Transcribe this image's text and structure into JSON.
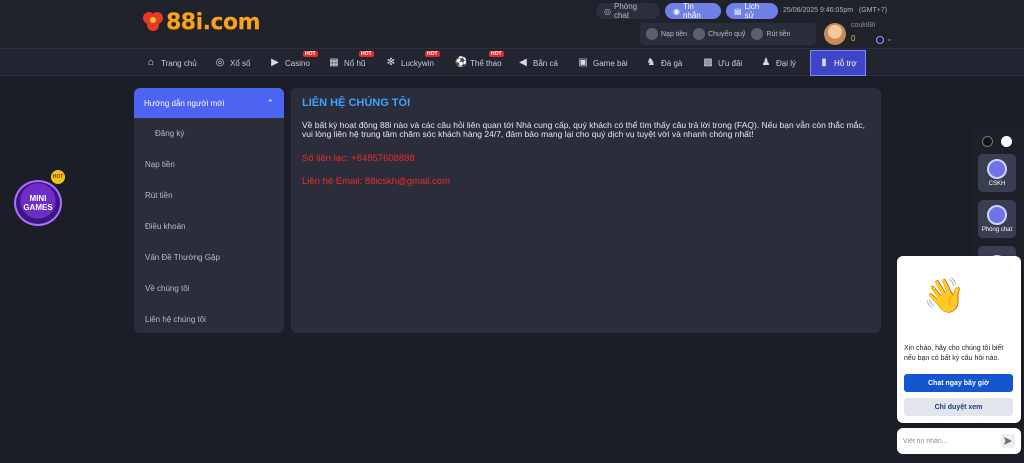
{
  "header": {
    "logo_text": "88i.com",
    "chat_room_label": "Phòng chat",
    "messages_label": "Tin nhắn",
    "history_label": "Lịch sử",
    "datetime": "25/06/2025 9:46:05pm",
    "timezone": "(GMT+7)",
    "deposit_label": "Nạp tiền",
    "transfer_label": "Chuyển quỹ",
    "withdraw_label": "Rút tiền",
    "username": "couk88i",
    "balance": "0"
  },
  "nav": {
    "hot_tag": "HOT",
    "items": [
      {
        "label": "Trang chủ"
      },
      {
        "label": "Xổ số"
      },
      {
        "label": "Casino"
      },
      {
        "label": "Nổ hũ"
      },
      {
        "label": "Luckywin"
      },
      {
        "label": "Thể thao"
      },
      {
        "label": "Bắn cá"
      },
      {
        "label": "Game bài"
      },
      {
        "label": "Đá gà"
      },
      {
        "label": "Ưu đãi"
      },
      {
        "label": "Đại lý"
      },
      {
        "label": "Hỗ trợ"
      }
    ]
  },
  "sidebar": {
    "header": "Hướng dẫn người mới",
    "items": [
      {
        "label": "Đăng ký"
      },
      {
        "label": "Nạp tiền"
      },
      {
        "label": "Rút tiền"
      },
      {
        "label": "Điều khoản"
      },
      {
        "label": "Vấn Đề Thường Gặp"
      },
      {
        "label": "Về chúng tôi"
      },
      {
        "label": "Liên hệ chúng tôi"
      }
    ]
  },
  "content": {
    "title": "LIÊN HỆ CHÚNG TÔI",
    "body": "Về bất kỳ hoạt động 88i nào và các câu hỏi liên quan tới Nhà cung cấp, quý khách có thể tìm thấy câu trả lời trong (FAQ). Nếu bạn vẫn còn thắc mắc, vui lòng liên hệ trung tâm chăm sóc khách hàng 24/7, đảm bảo mang lại cho quý dịch vụ tuyệt vời và nhanh chóng nhất!",
    "phone": "Số liên lạc: +84857608888",
    "email": "Liên hệ Email: 88icskh@gmail.com"
  },
  "mini_games": {
    "label": "MINI GAMES",
    "badge": "HOT"
  },
  "rail": {
    "support_label": "CSKH",
    "chat_room_label": "Phòng chat"
  },
  "chat_widget": {
    "emoji": "👋",
    "message": "Xin chào, hãy cho chúng tôi biết nếu bạn có bất kỳ câu hỏi nào.",
    "chat_now": "Chat ngay bây giờ",
    "just_browse": "Chỉ duyệt xem",
    "input_placeholder": "Viết tin nhắn..."
  },
  "colors": {
    "accent": "#4d63f2",
    "title_blue": "#3ea1ff",
    "contact_red": "#ea2a2a",
    "logo_orange": "#f7a41d"
  }
}
